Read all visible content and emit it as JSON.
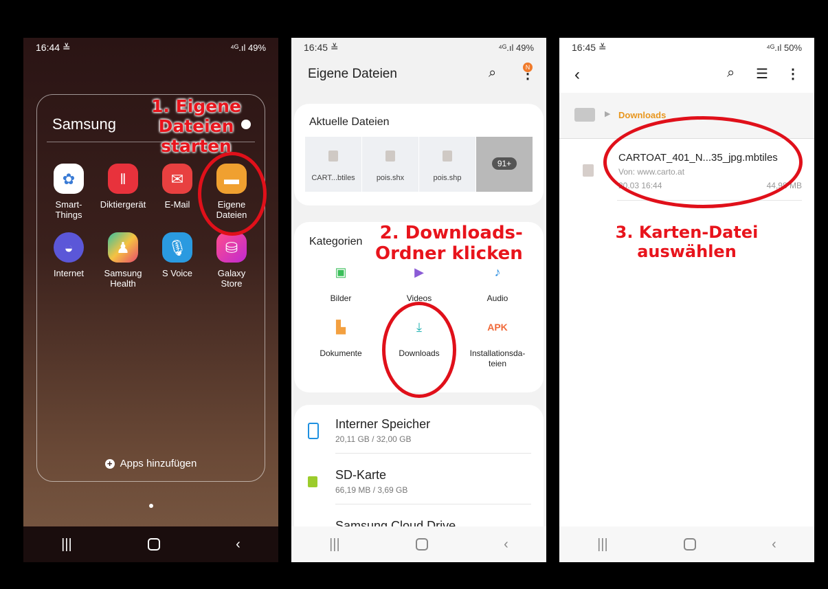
{
  "phone1": {
    "time": "16:44 ≚",
    "status_right": "⁴ᴳ.ıl 49%",
    "folder_title": "Samsung",
    "apps": [
      {
        "label": "Smart-\nThings",
        "icon": "smartthings-icon",
        "color": "#ffffff"
      },
      {
        "label": "Diktiergerät",
        "icon": "voice-recorder-icon",
        "color": "#e8323c"
      },
      {
        "label": "E-Mail",
        "icon": "email-icon",
        "color": "#e84040"
      },
      {
        "label": "Eigene\nDateien",
        "icon": "folder-icon",
        "color": "#f0a030"
      },
      {
        "label": "Internet",
        "icon": "internet-icon",
        "color": "#5b57d8"
      },
      {
        "label": "Samsung\nHealth",
        "icon": "health-icon",
        "color": "#3bb5a0"
      },
      {
        "label": "S Voice",
        "icon": "mic-icon",
        "color": "#2a9ae0"
      },
      {
        "label": "Galaxy\nStore",
        "icon": "store-icon",
        "color": "#e23a8a"
      }
    ],
    "add_apps": "Apps hinzufügen",
    "callout": "1. Eigene Dateien\nstarten"
  },
  "phone2": {
    "time": "16:45 ≚",
    "status_right": "⁴ᴳ.ıl 49%",
    "title": "Eigene Dateien",
    "badge": "N",
    "recent_title": "Aktuelle Dateien",
    "recent_files": [
      "CART...btiles",
      "pois.shx",
      "pois.shp"
    ],
    "more_count": "91+",
    "categories_title": "Kategorien",
    "categories": [
      {
        "label": "Bilder",
        "icon": "image-icon",
        "color": "#3bbf5a"
      },
      {
        "label": "Videos",
        "icon": "video-icon",
        "color": "#8b5cd6"
      },
      {
        "label": "Audio",
        "icon": "audio-icon",
        "color": "#2a8ee0"
      },
      {
        "label": "Dokumente",
        "icon": "document-icon",
        "color": "#f3a040"
      },
      {
        "label": "Downloads",
        "icon": "download-icon",
        "color": "#1bb0b0"
      },
      {
        "label": "Installationsda-\nteien",
        "icon": "apk-icon",
        "color": "#f06a3a",
        "text": "APK"
      }
    ],
    "storage": [
      {
        "name": "Interner Speicher",
        "detail": "20,11 GB / 32,00 GB"
      },
      {
        "name": "SD-Karte",
        "detail": "66,19 MB / 3,69 GB"
      },
      {
        "name": "Samsung Cloud Drive",
        "detail": ""
      }
    ],
    "callout": "2. Downloads-\nOrdner klicken"
  },
  "phone3": {
    "time": "16:45 ≚",
    "status_right": "⁴ᴳ.ıl 50%",
    "breadcrumb": "Downloads",
    "file": {
      "name": "CARTOAT_401_N...35_jpg.mbtiles",
      "source": "Von: www.carto.at",
      "date": "20.03 16:44",
      "size": "44,98 MB"
    },
    "callout": "3. Karten-Datei\nauswählen"
  }
}
